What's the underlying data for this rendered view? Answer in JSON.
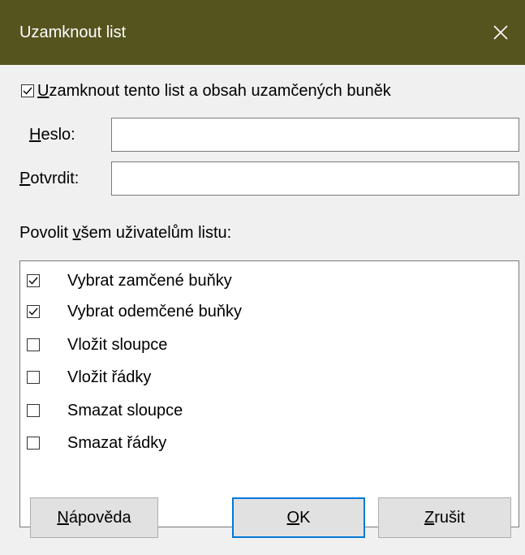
{
  "dialog": {
    "title": "Uzamknout list",
    "close_glyph": "✕"
  },
  "protect": {
    "checked": true,
    "label_accel": "U",
    "label_rest": "zamknout tento list a obsah uzamčených buněk"
  },
  "password": {
    "label_accel": "H",
    "label_rest": "eslo:",
    "value": ""
  },
  "confirm": {
    "label_accel": "P",
    "label_rest": "otvrdit:",
    "value": ""
  },
  "allow_section": {
    "label_pre": "Povolit ",
    "label_accel": "v",
    "label_rest": "šem uživatelům listu:"
  },
  "permissions": [
    {
      "label": "Vybrat zamčené buňky",
      "checked": true
    },
    {
      "label": "Vybrat odemčené buňky",
      "checked": true
    },
    {
      "label": "Vložit sloupce",
      "checked": false
    },
    {
      "label": "Vložit řádky",
      "checked": false
    },
    {
      "label": "Smazat sloupce",
      "checked": false
    },
    {
      "label": "Smazat řádky",
      "checked": false
    }
  ],
  "buttons": {
    "help": {
      "accel": "N",
      "rest": "ápověda"
    },
    "ok": {
      "accel": "O",
      "rest": "K"
    },
    "cancel": {
      "accel": "Z",
      "rest": "rušit"
    }
  },
  "colors": {
    "titlebar": "#55541f",
    "default_button_border": "#0078d7"
  }
}
